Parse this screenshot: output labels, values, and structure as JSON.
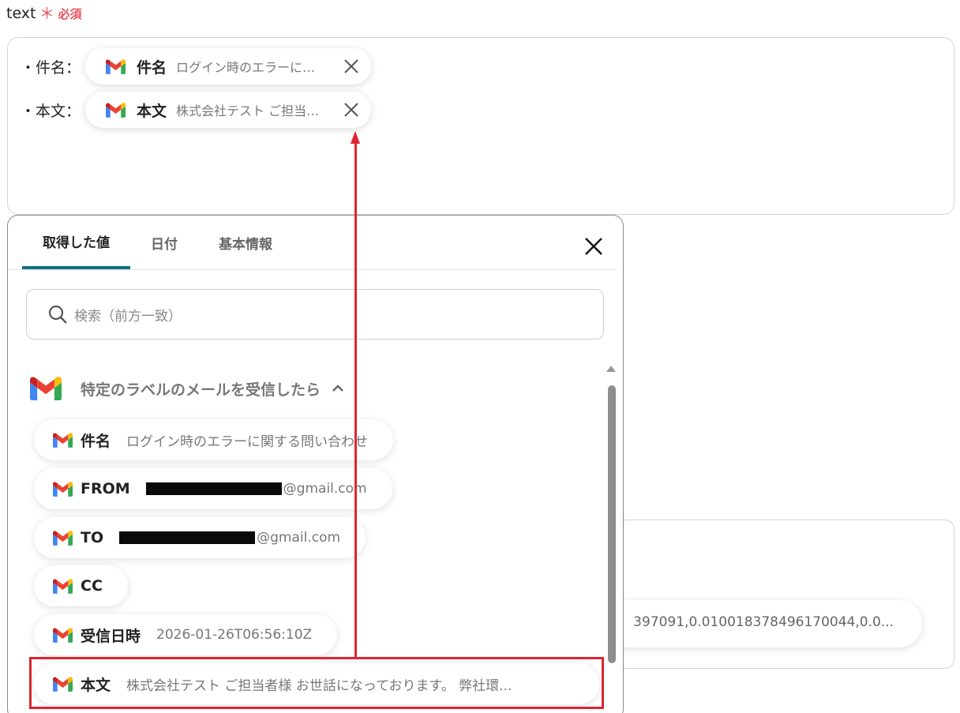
{
  "field": {
    "label": "text",
    "required_mark": "＊",
    "required_text": "必須"
  },
  "text_area": {
    "lines": [
      {
        "label": "・件名：",
        "tag_name": "件名",
        "tag_value": "ログイン時のエラーに関する問い合わせ"
      },
      {
        "label": "・本文：",
        "tag_name": "本文",
        "tag_value": "株式会社テスト ご担当者様 お世話になっております。 弊社環..."
      }
    ]
  },
  "background": {
    "chip_text": "397091,0.010018378496170044,0.0..."
  },
  "popup": {
    "tabs": [
      {
        "label": "取得した値",
        "active": true
      },
      {
        "label": "日付",
        "active": false
      },
      {
        "label": "基本情報",
        "active": false
      }
    ],
    "search_placeholder": "検索（前方一致）",
    "group_title": "特定のラベルのメールを受信したら",
    "items": [
      {
        "name": "件名",
        "value": "ログイン時のエラーに関する問い合わせ"
      },
      {
        "name": "FROM",
        "value": "@gmail.com",
        "redacted": true
      },
      {
        "name": "TO",
        "value": "@gmail.com",
        "redacted": true
      },
      {
        "name": "CC",
        "value": ""
      },
      {
        "name": "受信日時",
        "value": "2026-01-26T06:56:10Z"
      },
      {
        "name": "本文",
        "value": "株式会社テスト ご担当者様 お世話になっております。 弊社環..."
      }
    ]
  },
  "icons": {
    "gmail": "gmail-icon",
    "close": "close-icon",
    "search": "search-icon",
    "caret": "chevron-up-icon"
  },
  "colors": {
    "accent_tab": "#0d6f80",
    "required": "#e8505b",
    "annotation": "#e02430"
  }
}
